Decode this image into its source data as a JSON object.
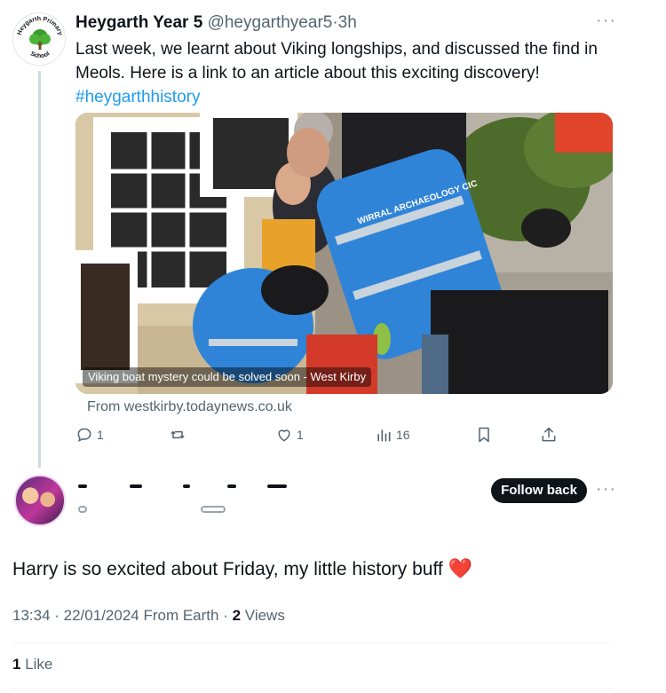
{
  "parent_tweet": {
    "avatar_text": "Heygarth Primary School",
    "display_name": "Heygarth Year 5",
    "handle": "@heygarthyear5",
    "separator": "·",
    "age": "3h",
    "text": "Last week, we learnt about Viking longships, and discussed the find in Meols. Here is a link to an article about this exciting discovery!",
    "hashtag": "#heygarthhistory",
    "media": {
      "caption": "Viking boat mystery could be solved soon - West Kirby",
      "vest_text": "WIRRAL ARCHAEOLOGY CIC"
    },
    "link_source": "From westkirby.todaynews.co.uk",
    "actions": {
      "replies": "1",
      "retweets": "",
      "likes": "1",
      "views": "16"
    },
    "more_icon": "more-dots-icon"
  },
  "reply_tweet": {
    "follow_label": "Follow back",
    "text": "Harry is so excited about Friday, my little history buff",
    "emoji": "❤️",
    "timestamp": "13:34 · 22/01/2024 From Earth · ",
    "views_count": "2",
    "views_label": " Views",
    "likes_count": "1",
    "likes_label": " Like"
  },
  "colors": {
    "accent": "#1d9bf0",
    "text": "#0f1419",
    "muted": "#536471",
    "heart": "#e0245e"
  }
}
